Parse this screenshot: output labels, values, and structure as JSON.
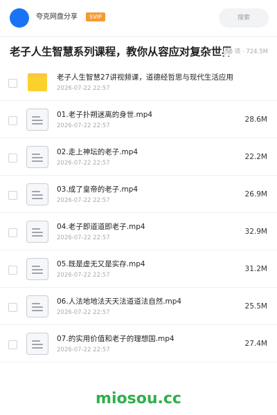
{
  "header": {
    "share_name": "夸克网盘分享",
    "badge": "SVIP",
    "search_placeholder": "搜索"
  },
  "title": "老子人生智慧系列课程，教你从容应对复杂世界",
  "meta": "58 项 · 724.5M",
  "items": [
    {
      "type": "folder",
      "name": "老子人生智慧27讲视频课，道德经哲思与现代生活应用",
      "date": "2026-07-22 22:57",
      "size": ""
    },
    {
      "type": "file",
      "name": "01.老子扑朔迷离的身世.mp4",
      "date": "2026-07-22 22:57",
      "size": "28.6M"
    },
    {
      "type": "file",
      "name": "02.走上神坛的老子.mp4",
      "date": "2026-07-22 22:57",
      "size": "22.2M"
    },
    {
      "type": "file",
      "name": "03.成了皇帝的老子.mp4",
      "date": "2026-07-22 22:57",
      "size": "26.9M"
    },
    {
      "type": "file",
      "name": "04.老子即道道即老子.mp4",
      "date": "2026-07-22 22:57",
      "size": "32.9M"
    },
    {
      "type": "file",
      "name": "05.既是虚无又是实存.mp4",
      "date": "2026-07-22 22:57",
      "size": "31.2M"
    },
    {
      "type": "file",
      "name": "06.人法地地法天天法道道法自然.mp4",
      "date": "2026-07-22 22:57",
      "size": "25.5M"
    },
    {
      "type": "file",
      "name": "07.的实用价值和老子的理想国.mp4",
      "date": "2026-07-22 22:57",
      "size": "27.4M"
    }
  ],
  "watermark": "miosou.cc",
  "colors": {
    "avatar": "#1a73f5",
    "badge": "#f39a35",
    "folder": "#fcd02d",
    "watermark": "#2fb04a"
  }
}
